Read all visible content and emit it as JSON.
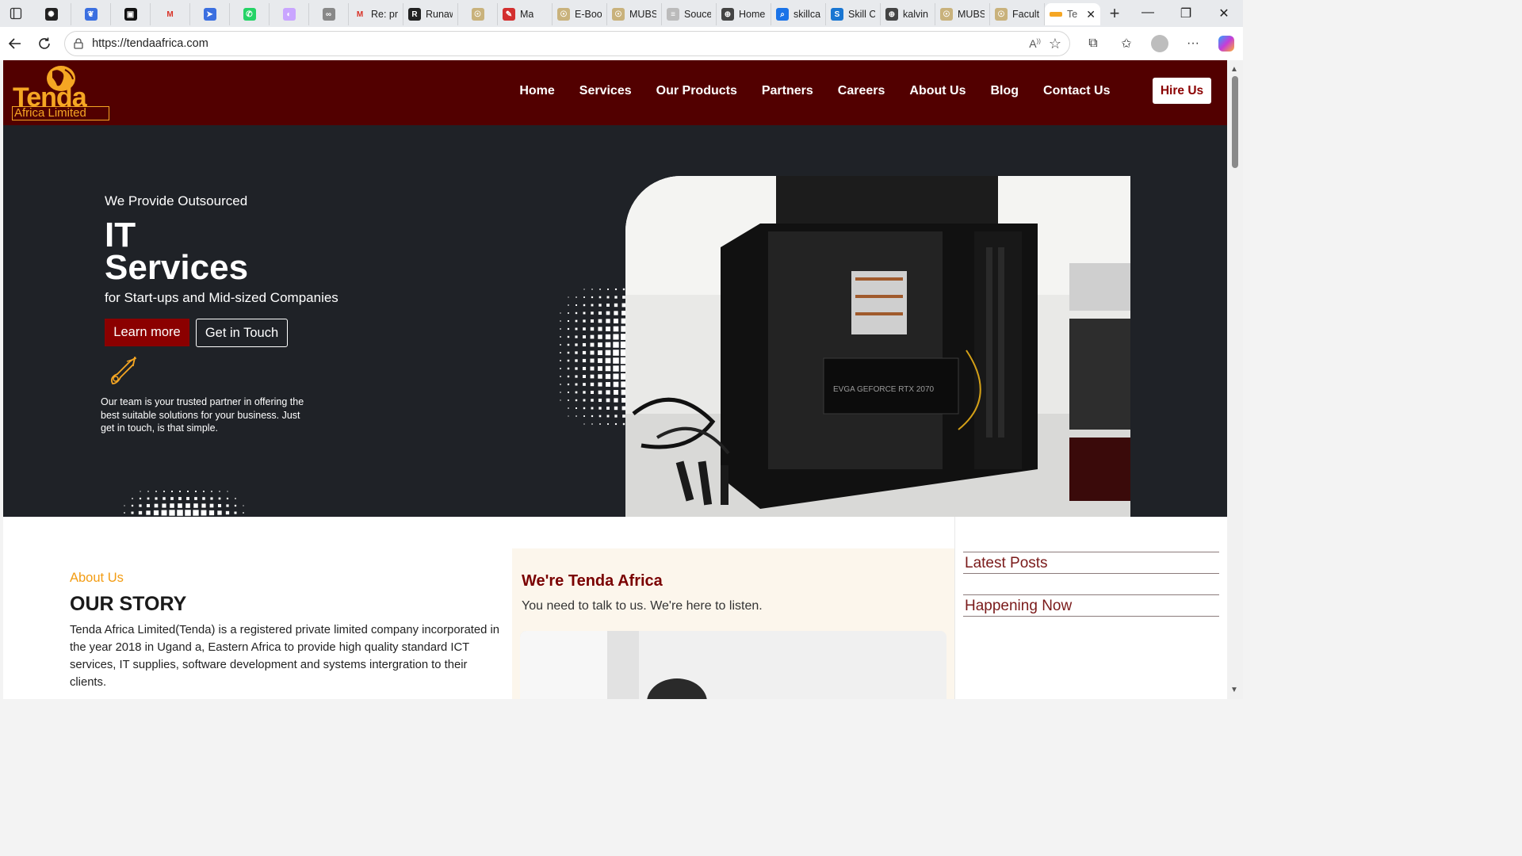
{
  "browser": {
    "tabs": [
      {
        "title": "",
        "icon": "openai-icon"
      },
      {
        "title": "",
        "icon": "copilot-icon"
      },
      {
        "title": "",
        "icon": "terminal-icon"
      },
      {
        "title": "",
        "icon": "gmail-icon"
      },
      {
        "title": "",
        "icon": "send-icon"
      },
      {
        "title": "",
        "icon": "whatsapp-icon"
      },
      {
        "title": "",
        "icon": "circle-icon"
      },
      {
        "title": "",
        "icon": "link-icon"
      },
      {
        "title": "Re: pro",
        "icon": "gmail-icon"
      },
      {
        "title": "Runaw",
        "icon": "r-icon"
      },
      {
        "title": "",
        "icon": "university-icon"
      },
      {
        "title": "Ma",
        "icon": "pen-icon"
      },
      {
        "title": "E-Boo",
        "icon": "university-icon"
      },
      {
        "title": "MUBS",
        "icon": "university-icon"
      },
      {
        "title": "Souce",
        "icon": "doc-icon"
      },
      {
        "title": "Home",
        "icon": "globe-icon"
      },
      {
        "title": "skillca",
        "icon": "search-icon"
      },
      {
        "title": "Skill C",
        "icon": "s-icon"
      },
      {
        "title": "kalvin",
        "icon": "globe-icon"
      },
      {
        "title": "MUBS",
        "icon": "university-icon"
      },
      {
        "title": "Faculti",
        "icon": "university-icon"
      }
    ],
    "active_tab": "Te",
    "url": "https://tendaafrica.com"
  },
  "site": {
    "logo": {
      "word": "Tenda",
      "sub": "Africa Limited"
    },
    "nav": [
      "Home",
      "Services",
      "Our Products",
      "Partners",
      "Careers",
      "About Us",
      "Blog",
      "Contact Us"
    ],
    "cta": "Hire Us",
    "colors": {
      "brand": "#520000",
      "accent": "#f5a623",
      "hero_bg": "#1f2227",
      "button": "#8b0000"
    }
  },
  "hero": {
    "kicker": "We Provide Outsourced",
    "headline_1": "IT",
    "headline_2": "Services",
    "subline": "for Start-ups and Mid-sized Companies",
    "btn_primary": "Learn more",
    "btn_secondary": "Get in Touch",
    "para": "Our team is your trusted partner in offering the best suitable solutions for your business. Just get in touch, is that simple."
  },
  "about": {
    "label": "About Us",
    "title": "OUR STORY",
    "text": "Tenda Africa Limited(Tenda) is a registered private limited company incorporated in the year 2018 in Ugand a, Eastern Africa to provide high quality standard ICT services, IT supplies, software development and systems intergration to their clients."
  },
  "promo": {
    "title": "We're Tenda Africa",
    "text": "You need to talk to us. We're here to listen."
  },
  "sidebar": {
    "latest": "Latest Posts",
    "happening": "Happening Now"
  }
}
